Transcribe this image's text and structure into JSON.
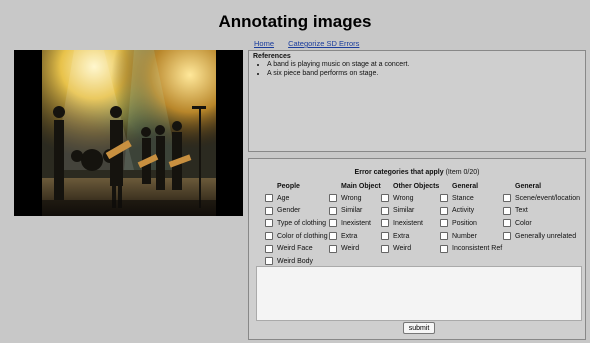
{
  "title": "Annotating images",
  "nav": {
    "home": "Home",
    "categorize": "Categorize SD Errors"
  },
  "references": {
    "title": "References",
    "items": [
      "A band is playing music on stage at a concert.",
      "A six piece band performs on stage."
    ]
  },
  "errors": {
    "heading": "Error categories that apply",
    "item_info": "(Item 0/20)",
    "columns": [
      {
        "title": "People",
        "options": [
          "Age",
          "Gender",
          "Type of clothing",
          "Color of clothing",
          "Weird Face",
          "Weird Body"
        ]
      },
      {
        "title": "Main Object",
        "options": [
          "Wrong",
          "Similar",
          "Inexistent",
          "Extra",
          "Weird"
        ]
      },
      {
        "title": "Other Objects",
        "options": [
          "Wrong",
          "Similar",
          "Inexistent",
          "Extra",
          "Weird"
        ]
      },
      {
        "title": "General",
        "options": [
          "Stance",
          "Activity",
          "Position",
          "Number",
          "Inconsistent Ref"
        ]
      },
      {
        "title": "General",
        "options": [
          "Scene/event/location",
          "Text",
          "Color",
          "Generally unrelated"
        ]
      }
    ],
    "notes_value": "",
    "submit_label": "submit"
  }
}
